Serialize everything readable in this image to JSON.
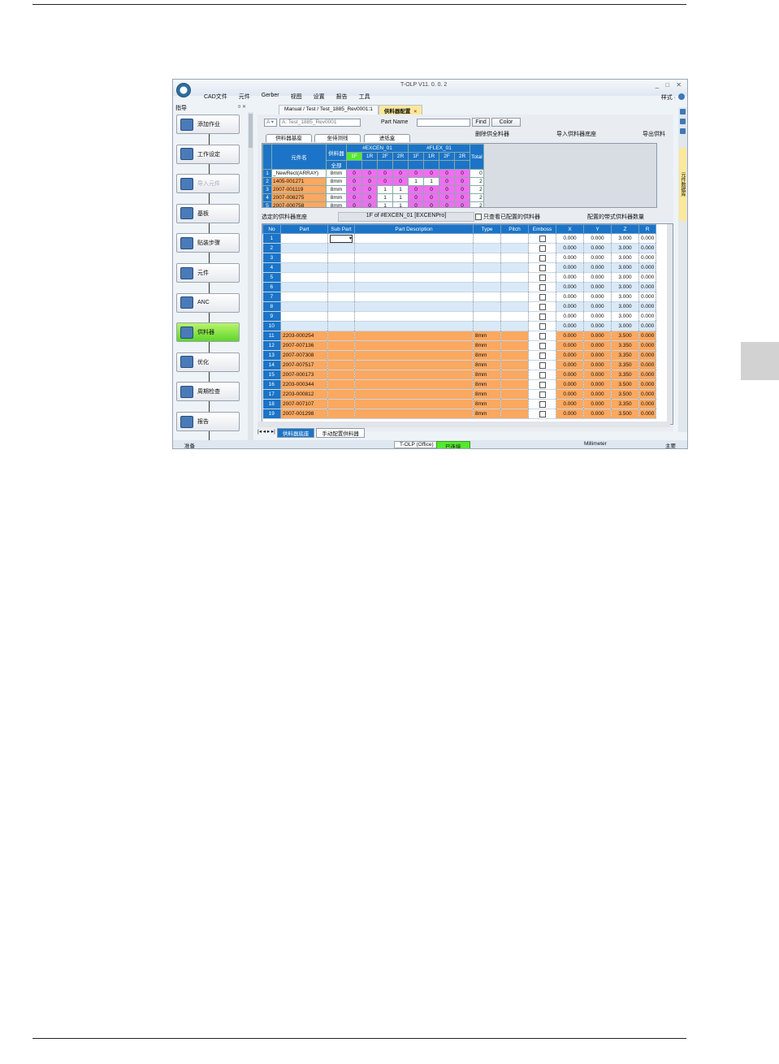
{
  "window": {
    "title": "T-OLP V11. 0. 0. 2",
    "controls": "_ □ ✕",
    "menu": [
      "CAD文件",
      "元件",
      "Gerber",
      "视图",
      "设置",
      "报告",
      "工具"
    ],
    "style_menu": "样式 ·"
  },
  "nav": {
    "header": "指导",
    "pin": "¤ ✕",
    "steps": [
      {
        "label": "添加作业",
        "state": "normal"
      },
      {
        "label": "工作设定",
        "state": "normal"
      },
      {
        "label": "导入元件",
        "state": "disabled"
      },
      {
        "label": "基板",
        "state": "normal"
      },
      {
        "label": "贴装步骤",
        "state": "normal"
      },
      {
        "label": "元件",
        "state": "normal"
      },
      {
        "label": "ANC",
        "state": "normal"
      },
      {
        "label": "供料器",
        "state": "active"
      },
      {
        "label": "优化",
        "state": "normal"
      },
      {
        "label": "周期检查",
        "state": "normal"
      },
      {
        "label": "报告",
        "state": "normal"
      }
    ]
  },
  "doc_tabs": [
    {
      "label": "Manual / Test / Test_1885_Rev0001:1",
      "active": false
    },
    {
      "label": "供料器配置",
      "active": true
    }
  ],
  "toolbar": {
    "combo_small": "A",
    "combo_job": "A: Test_1885_Rev0001",
    "part_name_label": "Part Name",
    "part_name_value": "",
    "find_label": "Find",
    "color_label": "Color",
    "delete_all": "删除供全料器",
    "import_lib": "导入供料器底座",
    "export": "导出供料"
  },
  "subtabs": [
    "供料器基座",
    "坐待测线",
    "进纸盒"
  ],
  "feeder_grid": {
    "col_part": "元件名",
    "col_feeder": "供料器",
    "col_total": "Total",
    "group1": "#EXCEN_01",
    "group2": "#FLEX_01",
    "sub_all": "全部",
    "subcols": [
      "1F",
      "1R",
      "2F",
      "2R",
      "1F",
      "1R",
      "2F",
      "2R"
    ],
    "rows": [
      {
        "no": "1",
        "part": "_NewRect(ARRAY)",
        "feeder": "8mm",
        "vals": [
          "0",
          "0",
          "0",
          "0",
          "0",
          "0",
          "0",
          "0"
        ],
        "total": "0"
      },
      {
        "no": "2",
        "part": "1405-001271",
        "feeder": "8mm",
        "vals": [
          "0",
          "0",
          "0",
          "0",
          "1",
          "1",
          "0",
          "0"
        ],
        "total": "2"
      },
      {
        "no": "3",
        "part": "2007-001119",
        "feeder": "8mm",
        "vals": [
          "0",
          "0",
          "1",
          "1",
          "0",
          "0",
          "0",
          "0"
        ],
        "total": "2"
      },
      {
        "no": "4",
        "part": "2007-008275",
        "feeder": "8mm",
        "vals": [
          "0",
          "0",
          "1",
          "1",
          "0",
          "0",
          "0",
          "0"
        ],
        "total": "2"
      },
      {
        "no": "5",
        "part": "2007-000758",
        "feeder": "8mm",
        "vals": [
          "0",
          "0",
          "1",
          "1",
          "0",
          "0",
          "0",
          "0"
        ],
        "total": "2"
      }
    ]
  },
  "selected_bar": {
    "label": "选定的供料器底座",
    "value": "1F of #EXCEN_01 [EXCENPro]",
    "only_configured": "只查看已配置的供料器",
    "count_label": "配置的带式供料器数量"
  },
  "placement_grid": {
    "headers": [
      "No",
      "Part",
      "Sub Part",
      "Part Description",
      "Type",
      "Pitch",
      "Emboss",
      "X",
      "Y",
      "Z",
      "R"
    ],
    "rows": [
      {
        "no": "1",
        "part": "",
        "type": "",
        "x": "0.000",
        "y": "0.000",
        "z": "3.000",
        "r": "0.000",
        "style": "white"
      },
      {
        "no": "2",
        "part": "",
        "type": "",
        "x": "0.000",
        "y": "0.000",
        "z": "3.000",
        "r": "0.000",
        "style": "blue"
      },
      {
        "no": "3",
        "part": "",
        "type": "",
        "x": "0.000",
        "y": "0.000",
        "z": "3.000",
        "r": "0.000",
        "style": "white"
      },
      {
        "no": "4",
        "part": "",
        "type": "",
        "x": "0.000",
        "y": "0.000",
        "z": "3.000",
        "r": "0.000",
        "style": "blue"
      },
      {
        "no": "5",
        "part": "",
        "type": "",
        "x": "0.000",
        "y": "0.000",
        "z": "3.000",
        "r": "0.000",
        "style": "white"
      },
      {
        "no": "6",
        "part": "",
        "type": "",
        "x": "0.000",
        "y": "0.000",
        "z": "3.000",
        "r": "0.000",
        "style": "blue"
      },
      {
        "no": "7",
        "part": "",
        "type": "",
        "x": "0.000",
        "y": "0.000",
        "z": "3.000",
        "r": "0.000",
        "style": "white"
      },
      {
        "no": "8",
        "part": "",
        "type": "",
        "x": "0.000",
        "y": "0.000",
        "z": "3.000",
        "r": "0.000",
        "style": "blue"
      },
      {
        "no": "9",
        "part": "",
        "type": "",
        "x": "0.000",
        "y": "0.000",
        "z": "3.000",
        "r": "0.000",
        "style": "white"
      },
      {
        "no": "10",
        "part": "",
        "type": "",
        "x": "0.000",
        "y": "0.000",
        "z": "3.000",
        "r": "0.000",
        "style": "blue"
      },
      {
        "no": "11",
        "part": "2203-000254",
        "type": "8mm",
        "x": "0.000",
        "y": "0.000",
        "z": "3.500",
        "r": "0.000",
        "style": "orange"
      },
      {
        "no": "12",
        "part": "2007-007136",
        "type": "8mm",
        "x": "0.000",
        "y": "0.000",
        "z": "3.350",
        "r": "0.000",
        "style": "orange"
      },
      {
        "no": "13",
        "part": "2007-007308",
        "type": "8mm",
        "x": "0.000",
        "y": "0.000",
        "z": "3.350",
        "r": "0.000",
        "style": "orange"
      },
      {
        "no": "14",
        "part": "2007-007517",
        "type": "8mm",
        "x": "0.000",
        "y": "0.000",
        "z": "3.350",
        "r": "0.000",
        "style": "orange"
      },
      {
        "no": "15",
        "part": "2007-000173",
        "type": "8mm",
        "x": "0.000",
        "y": "0.000",
        "z": "3.350",
        "r": "0.000",
        "style": "orange"
      },
      {
        "no": "16",
        "part": "2203-000344",
        "type": "8mm",
        "x": "0.000",
        "y": "0.000",
        "z": "3.500",
        "r": "0.000",
        "style": "orange"
      },
      {
        "no": "17",
        "part": "2203-000812",
        "type": "8mm",
        "x": "0.000",
        "y": "0.000",
        "z": "3.500",
        "r": "0.000",
        "style": "orange"
      },
      {
        "no": "18",
        "part": "2007-007107",
        "type": "8mm",
        "x": "0.000",
        "y": "0.000",
        "z": "3.350",
        "r": "0.000",
        "style": "orange"
      },
      {
        "no": "19",
        "part": "2007-001298",
        "type": "8mm",
        "x": "0.000",
        "y": "0.000",
        "z": "3.500",
        "r": "0.000",
        "style": "orange"
      }
    ]
  },
  "sheet_tabs": [
    "供料器底座",
    "手动配置供料器"
  ],
  "sheet_nav": "|◂ ◂ ▸ ▸|",
  "right_strip_tab": "元件数据库",
  "status": {
    "left": "准备",
    "office": "T-OLP (Office)",
    "connected": "已连接",
    "unit": "Millimeter",
    "right": "主要"
  },
  "colors": {
    "header_blue": "#1b74c7",
    "pink": "#f16df1",
    "orange": "#fba860",
    "active_green": "#55e830"
  }
}
